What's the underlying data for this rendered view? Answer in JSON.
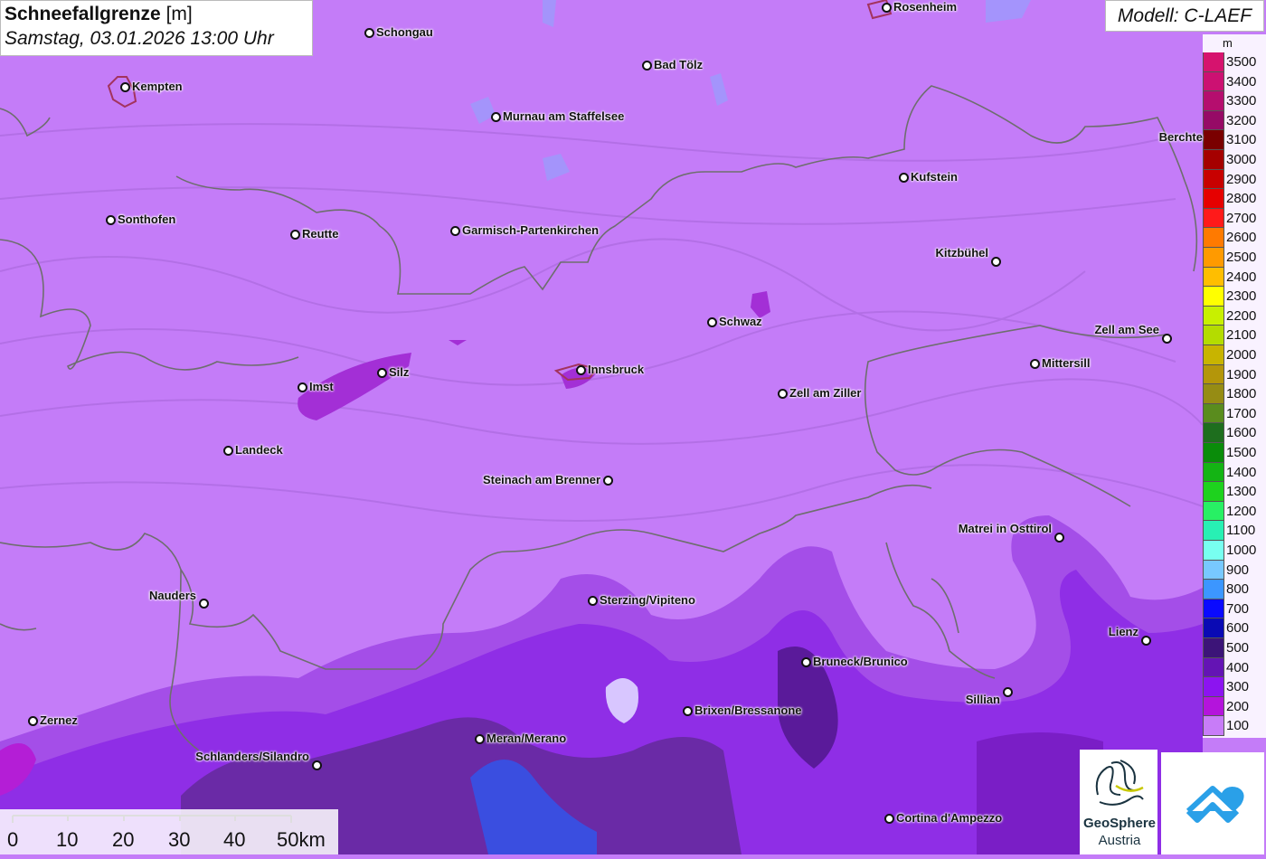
{
  "title": {
    "bold": "Schneefallgrenze",
    "unit": "[m]",
    "subtitle": "Samstag, 03.01.2026 13:00 Uhr"
  },
  "model": "Modell: C-LAEF",
  "legend": {
    "unit": "m",
    "items": [
      {
        "label": "3500",
        "color": "#d6136e"
      },
      {
        "label": "3400",
        "color": "#cc1172"
      },
      {
        "label": "3300",
        "color": "#b50e6e"
      },
      {
        "label": "3200",
        "color": "#960a66"
      },
      {
        "label": "3100",
        "color": "#7a0000"
      },
      {
        "label": "3000",
        "color": "#a50000"
      },
      {
        "label": "2900",
        "color": "#c80000"
      },
      {
        "label": "2800",
        "color": "#e60000"
      },
      {
        "label": "2700",
        "color": "#ff1a1a"
      },
      {
        "label": "2600",
        "color": "#ff7a00"
      },
      {
        "label": "2500",
        "color": "#ff9a00"
      },
      {
        "label": "2400",
        "color": "#ffbe00"
      },
      {
        "label": "2300",
        "color": "#ffff00"
      },
      {
        "label": "2200",
        "color": "#c8f000"
      },
      {
        "label": "2100",
        "color": "#b4dc00"
      },
      {
        "label": "2000",
        "color": "#c8b400"
      },
      {
        "label": "1900",
        "color": "#b4960a"
      },
      {
        "label": "1800",
        "color": "#968c14"
      },
      {
        "label": "1700",
        "color": "#5a8c1e"
      },
      {
        "label": "1600",
        "color": "#1e6e1e"
      },
      {
        "label": "1500",
        "color": "#0a8c0a"
      },
      {
        "label": "1400",
        "color": "#14b414"
      },
      {
        "label": "1300",
        "color": "#1ed21e"
      },
      {
        "label": "1200",
        "color": "#28f064"
      },
      {
        "label": "1100",
        "color": "#28f0b4"
      },
      {
        "label": "1000",
        "color": "#78fff0"
      },
      {
        "label": "900",
        "color": "#78c8ff"
      },
      {
        "label": "800",
        "color": "#3c96ff"
      },
      {
        "label": "700",
        "color": "#0a0aff"
      },
      {
        "label": "600",
        "color": "#0a0ab4"
      },
      {
        "label": "500",
        "color": "#3c1478"
      },
      {
        "label": "400",
        "color": "#6414b4"
      },
      {
        "label": "300",
        "color": "#8c14f0"
      },
      {
        "label": "200",
        "color": "#b414dc"
      },
      {
        "label": "100",
        "color": "#c87cf8"
      }
    ]
  },
  "places": [
    {
      "name": "Rosenheim"
    },
    {
      "name": "Schongau"
    },
    {
      "name": "Bad Tölz"
    },
    {
      "name": "Kempten"
    },
    {
      "name": "Murnau am Staffelsee"
    },
    {
      "name": "Berchte"
    },
    {
      "name": "Kufstein"
    },
    {
      "name": "Sonthofen"
    },
    {
      "name": "Reutte"
    },
    {
      "name": "Garmisch-Partenkirchen"
    },
    {
      "name": "Kitzbühel"
    },
    {
      "name": "Schwaz"
    },
    {
      "name": "Zell am See"
    },
    {
      "name": "Mittersill"
    },
    {
      "name": "Silz"
    },
    {
      "name": "Innsbruck"
    },
    {
      "name": "Imst"
    },
    {
      "name": "Zell am Ziller"
    },
    {
      "name": "Landeck"
    },
    {
      "name": "Steinach am Brenner"
    },
    {
      "name": "Matrei in Osttirol"
    },
    {
      "name": "Nauders"
    },
    {
      "name": "Sterzing/Vipiteno"
    },
    {
      "name": "Lienz"
    },
    {
      "name": "Bruneck/Brunico"
    },
    {
      "name": "Sillian"
    },
    {
      "name": "Zernez"
    },
    {
      "name": "Brixen/Bressanone"
    },
    {
      "name": "Meran/Merano"
    },
    {
      "name": "Schlanders/Silandro"
    },
    {
      "name": "Cortina d'Ampezzo"
    }
  ],
  "scale": {
    "labels": [
      "0",
      "10",
      "20",
      "30",
      "40",
      "50km"
    ]
  },
  "logo": {
    "name": "GeoSphere",
    "country": "Austria"
  }
}
